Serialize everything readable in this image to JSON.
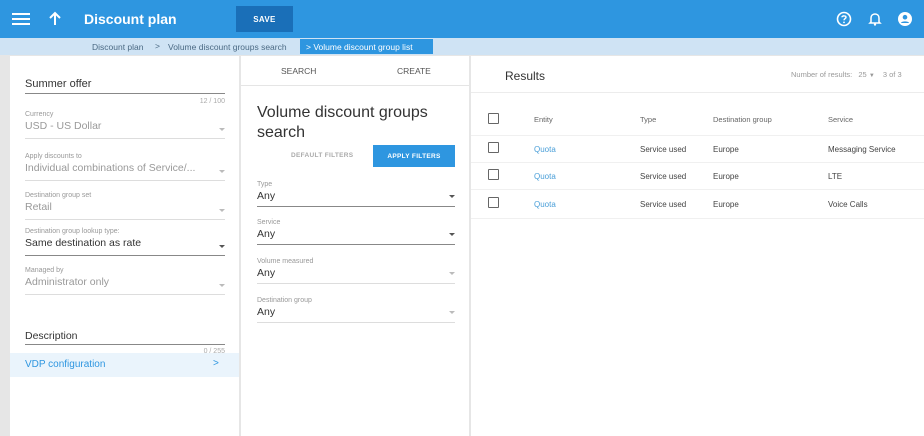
{
  "topbar": {
    "title": "Discount plan",
    "save_label": "SAVE"
  },
  "breadcrumb": {
    "item1": "Discount plan",
    "item2": "Volume discount groups search",
    "active": "Volume discount group list"
  },
  "left": {
    "name_value": "Summer offer",
    "name_counter": "12 / 100",
    "currency_label": "Currency",
    "currency_value": "USD - US Dollar",
    "apply_label": "Apply discounts to",
    "apply_value": "Individual combinations of Service/...",
    "destset_label": "Destination group set",
    "destset_value": "Retail",
    "lookup_label": "Destination group lookup type:",
    "lookup_value": "Same destination as rate",
    "managed_label": "Managed by",
    "managed_value": "Administrator only",
    "description_placeholder": "Description",
    "description_counter": "0 / 255",
    "vdp_label": "VDP configuration",
    "vdp_chevron": ">"
  },
  "middle": {
    "tab_search": "SEARCH",
    "tab_create": "CREATE",
    "title": "Volume discount groups search",
    "default_filters": "DEFAULT FILTERS",
    "apply_filters": "APPLY FILTERS",
    "filters": [
      {
        "label": "Type",
        "value": "Any"
      },
      {
        "label": "Service",
        "value": "Any"
      },
      {
        "label": "Volume measured",
        "value": "Any"
      },
      {
        "label": "Destination group",
        "value": "Any"
      }
    ]
  },
  "results": {
    "title": "Results",
    "count_text": "Number of results:",
    "page_size": "25",
    "page_info": "3 of 3",
    "columns": [
      "Entity",
      "Type",
      "Destination group",
      "Service"
    ],
    "rows": [
      [
        "Quota",
        "Service used",
        "Europe",
        "Messaging Service"
      ],
      [
        "Quota",
        "Service used",
        "Europe",
        "LTE"
      ],
      [
        "Quota",
        "Service used",
        "Europe",
        "Voice Calls"
      ]
    ]
  },
  "colors": {
    "accent": "#2e96e0",
    "save_bg": "#1a6fb8",
    "link": "#4a9fd8"
  }
}
